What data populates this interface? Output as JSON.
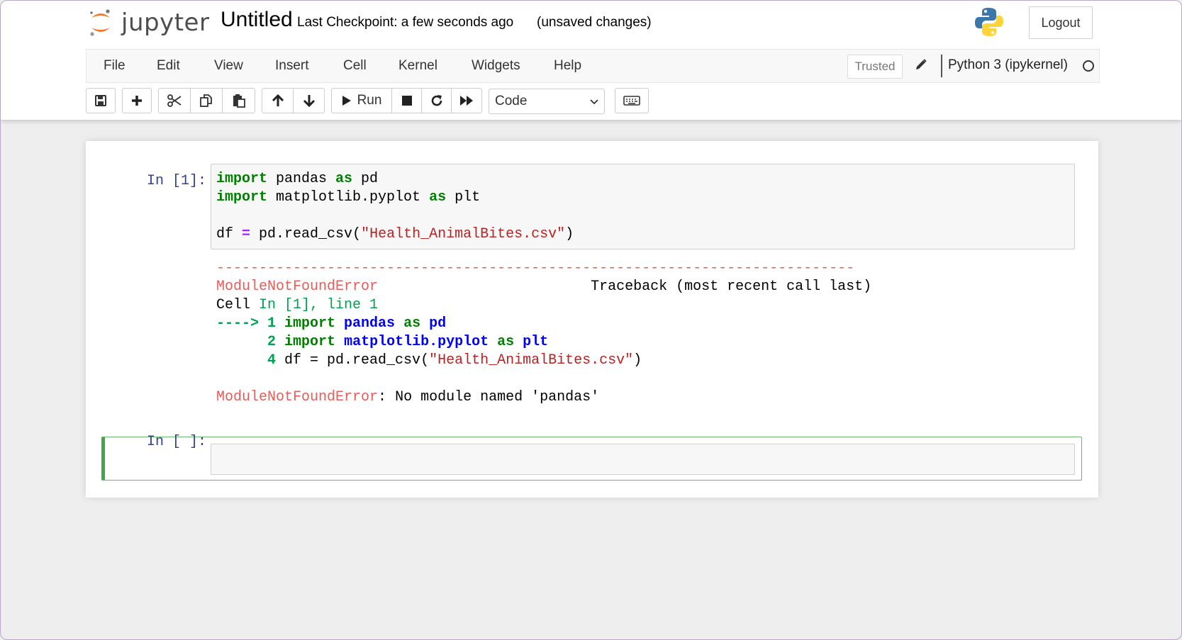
{
  "header": {
    "logo_text": "jupyter",
    "notebook_name": "Untitled",
    "checkpoint": "Last Checkpoint: a few seconds ago",
    "autosave_status": "(unsaved changes)",
    "logout_label": "Logout"
  },
  "menu": {
    "items": [
      "File",
      "Edit",
      "View",
      "Insert",
      "Cell",
      "Kernel",
      "Widgets",
      "Help"
    ],
    "trusted_label": "Trusted",
    "kernel_name": "Python 3 (ipykernel)"
  },
  "toolbar": {
    "run_label": "Run",
    "cell_type": "Code"
  },
  "cells": {
    "cell1": {
      "prompt": "In [1]:",
      "code": {
        "l1_kw": "import",
        "l1_mod": " pandas ",
        "l1_as": "as",
        "l1_alias": " pd",
        "l2_kw": "import",
        "l2_mod": " matplotlib.pyplot ",
        "l2_as": "as",
        "l2_alias": " plt",
        "l4_a": "df ",
        "l4_op": "=",
        "l4_b": " pd.read_csv(",
        "l4_str": "\"Health_AnimalBites.csv\"",
        "l4_c": ")"
      },
      "error": {
        "dashes": "---------------------------------------------------------------------------",
        "error_name": "ModuleNotFoundError",
        "traceback_label": "Traceback (most recent call last)",
        "cell_word": "Cell ",
        "cell_loc": "In [1], line 1",
        "arrow": "----> 1 ",
        "tb_l1_kw": "import",
        "tb_l1_mod": "pandas",
        "tb_l1_as": "as",
        "tb_l1_alias": "pd",
        "tb_l2_num": "2 ",
        "tb_l2_kw": "import",
        "tb_l2_mod": "matplotlib.pyplot",
        "tb_l2_as": "as",
        "tb_l2_alias": "plt",
        "tb_l4_num": "4 ",
        "tb_l4_a": "df = pd.read_csv(",
        "tb_l4_str": "\"Health_AnimalBites.csv\"",
        "tb_l4_c": ")",
        "final_sep": ": ",
        "final_msg": "No module named 'pandas'"
      }
    },
    "cell2": {
      "prompt": "In [ ]:"
    }
  },
  "colors": {
    "prompt": "#303f9f",
    "keyword": "#008000",
    "string": "#ba2121",
    "error_red": "#e75c58",
    "selected_border": "#42a548"
  }
}
